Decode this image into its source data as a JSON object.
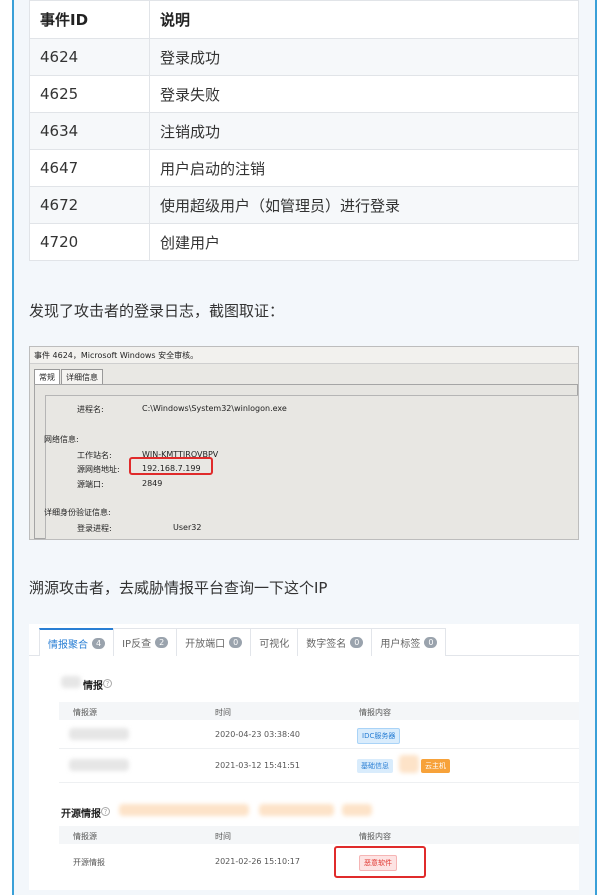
{
  "colors": {
    "accent": "#3aa0d8",
    "highlight_red": "#e02b2b",
    "link_blue": "#2a7fd4"
  },
  "event_table": {
    "headers": [
      "事件ID",
      "说明"
    ],
    "rows": [
      [
        "4624",
        "登录成功"
      ],
      [
        "4625",
        "登录失败"
      ],
      [
        "4634",
        "注销成功"
      ],
      [
        "4647",
        "用户启动的注销"
      ],
      [
        "4672",
        "使用超级用户（如管理员）进行登录"
      ],
      [
        "4720",
        "创建用户"
      ]
    ]
  },
  "para1": "发现了攻击者的登录日志，截图取证：",
  "para2": "溯源攻击者，去威胁情报平台查询一下这个IP",
  "win_shot": {
    "title": "事件 4624，Microsoft Windows 安全审核。",
    "tab_general": "常规",
    "tab_details": "详细信息",
    "process_name_label": "进程名:",
    "process_name_value": "C:\\Windows\\System32\\winlogon.exe",
    "network_info_label": "网络信息:",
    "workstation_label": "工作站名:",
    "workstation_value": "WIN-KMTTJROVBPV",
    "source_ip_label": "源网络地址:",
    "source_ip_value": "192.168.7.199",
    "source_port_label": "源端口:",
    "source_port_value": "2849",
    "auth_info_label": "详细身份验证信息:",
    "logon_process_label": "登录进程:",
    "logon_process_value": "User32"
  },
  "intel_shot": {
    "tabs": [
      {
        "label": "情报聚合",
        "count": "4"
      },
      {
        "label": "IP反查",
        "count": "2"
      },
      {
        "label": "开放端口",
        "count": "0"
      },
      {
        "label": "可视化",
        "count": ""
      },
      {
        "label": "数字签名",
        "count": "0"
      },
      {
        "label": "用户标签",
        "count": "0"
      }
    ],
    "section1_title": "情报",
    "section2_title": "开源情报",
    "col_source": "情报源",
    "col_time": "时间",
    "col_content": "情报内容",
    "s1_rows": [
      {
        "time": "2020-04-23 03:38:40",
        "tag": "IDC服务器"
      },
      {
        "time": "2021-03-12 15:41:51",
        "tag": "基础信息",
        "tag2": "云主机"
      }
    ],
    "s2_rows": [
      {
        "source": "开源情报",
        "time": "2021-02-26 15:10:17",
        "tag": "恶意软件"
      }
    ],
    "help_glyph": "?"
  }
}
